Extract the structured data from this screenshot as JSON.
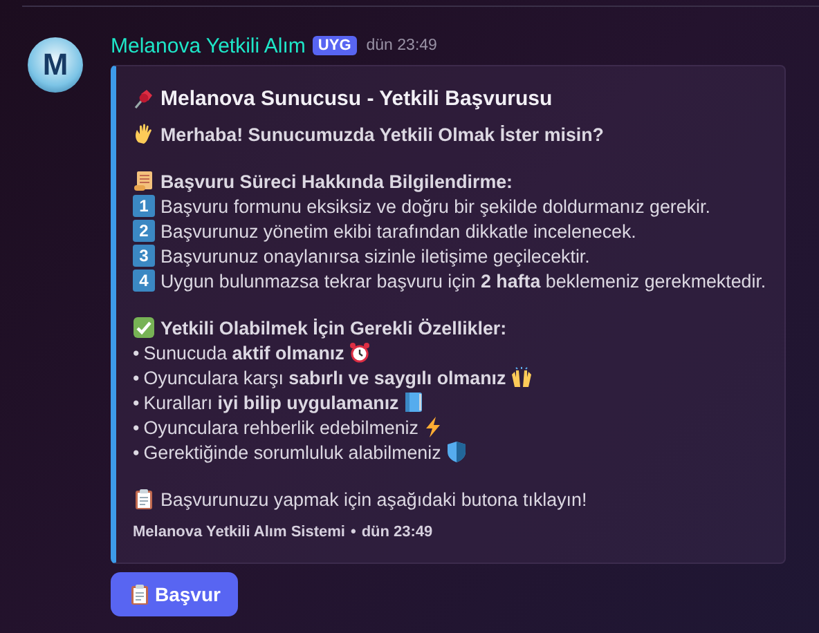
{
  "author": {
    "avatar_letter": "M",
    "name": "Melanova Yetkili Alım",
    "tag": "UYG",
    "time": "dün 23:49"
  },
  "embed": {
    "title": "Melanova Sunucusu - Yetkili Başvurusu",
    "intro": "Merhaba! Sunucumuzda Yetkili Olmak İster misin?",
    "process": {
      "heading": "Başvuru Süreci Hakkında Bilgilendirme:",
      "steps": [
        {
          "number": "1",
          "text": "Başvuru formunu eksiksiz ve doğru bir şekilde doldurmanız gerekir."
        },
        {
          "number": "2",
          "text": "Başvurunuz yönetim ekibi tarafından dikkatle incelenecek."
        },
        {
          "number": "3",
          "text": "Başvurunuz onaylanırsa sizinle iletişime geçilecektir."
        },
        {
          "number": "4",
          "text": "Uygun bulunmazsa tekrar başvuru için **2 hafta** beklemeniz gerekmektedir."
        }
      ]
    },
    "requirements": {
      "heading": "Yetkili Olabilmek İçin Gerekli Özellikler:",
      "items": [
        {
          "bullet": "•",
          "text": "Sunucuda **aktif olmanız**"
        },
        {
          "bullet": "•",
          "text": "Oyunculara karşı **sabırlı ve saygılı olmanız**"
        },
        {
          "bullet": "•",
          "text": "Kuralları **iyi bilip uygulamanız**"
        },
        {
          "bullet": "•",
          "text": "Oyunculara rehberlik edebilmeniz"
        },
        {
          "bullet": "•",
          "text": "Gerektiğinde sorumluluk alabilmeniz"
        }
      ]
    },
    "call_to_action": "Başvurunuzu yapmak için aşağıdaki butona tıklayın!",
    "footer": {
      "text": "Melanova Yetkili Alım Sistemi",
      "separator": "•",
      "time": "dün 23:49"
    }
  },
  "button": {
    "label": "Başvur"
  }
}
